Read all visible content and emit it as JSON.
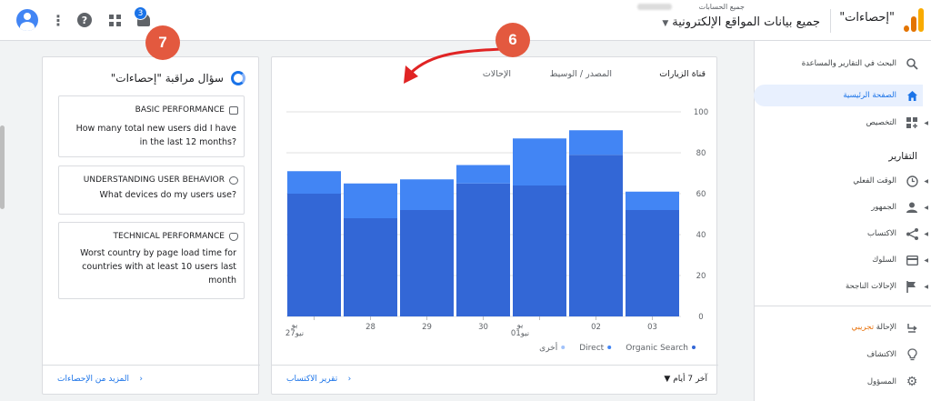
{
  "topbar": {
    "property_name": "\"إحصاءات\"",
    "breadcrumb": "جميع الحسابات",
    "view_name": "جميع بيانات المواقع الإلكترونية",
    "notification_count": "3",
    "help_glyph": "?",
    "kebab_glyph": "⋮"
  },
  "annotations": {
    "a6": "6",
    "a7": "7"
  },
  "sidebar": {
    "search_label": "البحث في التقارير والمساعدة",
    "home_label": "الصفحة الرئيسية",
    "customization_label": "التخصيص",
    "reports_heading": "التقارير",
    "reports": [
      {
        "label": "الوقت الفعلي",
        "icon": "clock-icon"
      },
      {
        "label": "الجمهور",
        "icon": "person-icon"
      },
      {
        "label": "الاكتساب",
        "icon": "acquisition-icon"
      },
      {
        "label": "السلوك",
        "icon": "behavior-icon"
      },
      {
        "label": "الإحالات الناجحة",
        "icon": "flag-icon"
      }
    ],
    "attribution_label": "الإحالة",
    "attribution_badge": "تجريبي",
    "discover_label": "الاكتشاف",
    "admin_label": "المسؤول",
    "accent": "#1a73e8"
  },
  "main_card": {
    "tabs": [
      "قناة الزيارات",
      "المصدر / الوسيط",
      "الإحالات"
    ],
    "date_range": "آخر 7 أيام",
    "report_link": "تقرير الاكتساب"
  },
  "chart_data": {
    "type": "bar",
    "stacked": true,
    "categories": [
      "27\nيو\nنيو",
      "28",
      "29",
      "30",
      "01\nيو\nنيو",
      "02",
      "03"
    ],
    "category_labels": [
      [
        "يو",
        "27نيو"
      ],
      [
        "28"
      ],
      [
        "29"
      ],
      [
        "30"
      ],
      [
        "يو",
        "01نيو"
      ],
      [
        "02"
      ],
      [
        "03"
      ]
    ],
    "series": [
      {
        "name": "Organic Search",
        "values": [
          60,
          48,
          52,
          65,
          64,
          79,
          52
        ],
        "color": "#3367d6"
      },
      {
        "name": "Direct",
        "values": [
          11,
          17,
          15,
          9,
          23,
          12,
          9
        ],
        "color": "#4285f4"
      },
      {
        "name": "أخرى",
        "values": [
          0,
          0,
          0,
          0,
          0,
          0,
          0
        ],
        "color": "#a1c2fa"
      }
    ],
    "ylim": [
      0,
      100
    ],
    "yticks": [
      0,
      20,
      40,
      60,
      80,
      100
    ],
    "grid": true,
    "legend_position": "bottom"
  },
  "insights": {
    "title": "سؤال مراقبة \"إحصاءات\"",
    "questions": [
      {
        "header": "BASIC PERFORMANCE",
        "icon": "card-icon",
        "text": "How many total new users did I have in the last 12 months?"
      },
      {
        "header": "UNDERSTANDING USER BEHAVIOR",
        "icon": "face-icon",
        "text": "What devices do my users use?"
      },
      {
        "header": "TECHNICAL PERFORMANCE",
        "icon": "bug-icon",
        "text": "Worst country by page load time for countries with at least 10 users last month"
      }
    ],
    "more_link": "المزيد من الإحصاءات"
  }
}
